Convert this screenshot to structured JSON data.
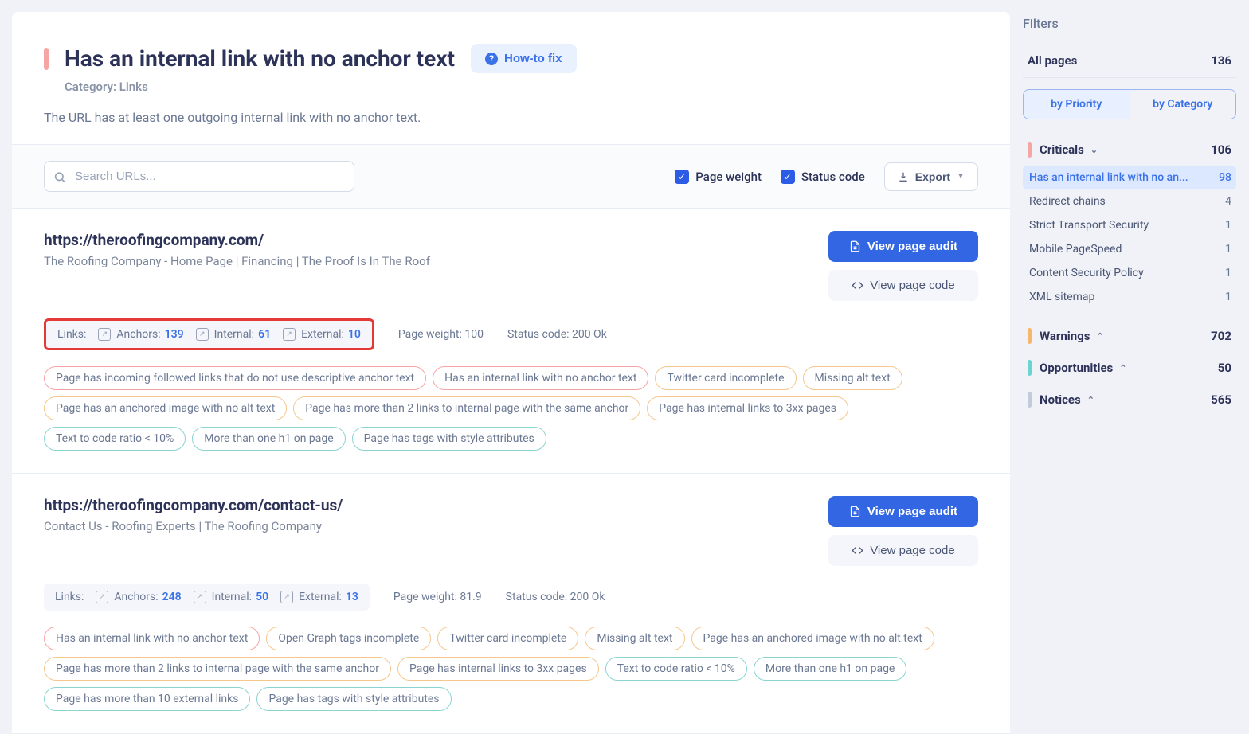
{
  "header": {
    "title": "Has an internal link with no anchor text",
    "howto": "How-to fix",
    "category": "Category: Links",
    "description": "The URL has at least one outgoing internal link with no anchor text."
  },
  "toolbar": {
    "search_placeholder": "Search URLs...",
    "page_weight": "Page weight",
    "status_code": "Status code",
    "export": "Export"
  },
  "labels": {
    "links": "Links:",
    "anchors": "Anchors:",
    "internal": "Internal:",
    "external": "External:",
    "page_weight": "Page weight:",
    "status_code": "Status code:",
    "view_audit": "View page audit",
    "view_code": "View page code"
  },
  "results": [
    {
      "url": "https://theroofingcompany.com/",
      "title": "The Roofing Company - Home Page | Financing | The Proof Is In The Roof",
      "highlighted": true,
      "anchors": "139",
      "internal": "61",
      "external": "10",
      "page_weight": "100",
      "status_code": "200 Ok",
      "tags": [
        {
          "t": "Page has incoming followed links that do not use descriptive anchor text",
          "c": "pink"
        },
        {
          "t": "Has an internal link with no anchor text",
          "c": "pink"
        },
        {
          "t": "Twitter card incomplete",
          "c": "orange"
        },
        {
          "t": "Missing alt text",
          "c": "orange"
        },
        {
          "t": "Page has an anchored image with no alt text",
          "c": "orange"
        },
        {
          "t": "Page has more than 2 links to internal page with the same anchor",
          "c": "orange"
        },
        {
          "t": "Page has internal links to 3xx pages",
          "c": "orange"
        },
        {
          "t": "Text to code ratio < 10%",
          "c": "teal"
        },
        {
          "t": "More than one h1 on page",
          "c": "teal"
        },
        {
          "t": "Page has tags with style attributes",
          "c": "teal"
        }
      ]
    },
    {
      "url": "https://theroofingcompany.com/contact-us/",
      "title": "Contact Us - Roofing Experts | The Roofing Company",
      "highlighted": false,
      "anchors": "248",
      "internal": "50",
      "external": "13",
      "page_weight": "81.9",
      "status_code": "200 Ok",
      "tags": [
        {
          "t": "Has an internal link with no anchor text",
          "c": "pink"
        },
        {
          "t": "Open Graph tags incomplete",
          "c": "orange"
        },
        {
          "t": "Twitter card incomplete",
          "c": "orange"
        },
        {
          "t": "Missing alt text",
          "c": "orange"
        },
        {
          "t": "Page has an anchored image with no alt text",
          "c": "orange"
        },
        {
          "t": "Page has more than 2 links to internal page with the same anchor",
          "c": "orange"
        },
        {
          "t": "Page has internal links to 3xx pages",
          "c": "orange"
        },
        {
          "t": "Text to code ratio < 10%",
          "c": "teal"
        },
        {
          "t": "More than one h1 on page",
          "c": "teal"
        },
        {
          "t": "Page has more than 10 external links",
          "c": "teal"
        },
        {
          "t": "Page has tags with style attributes",
          "c": "teal"
        }
      ]
    }
  ],
  "sidebar": {
    "title": "Filters",
    "all_pages": "All pages",
    "all_pages_count": "136",
    "tab_priority": "by Priority",
    "tab_category": "by Category",
    "sections": [
      {
        "name": "Criticals",
        "count": "106",
        "marker": "m-pink",
        "expanded": true,
        "items": [
          {
            "label": "Has an internal link with no an...",
            "count": "98",
            "active": true
          },
          {
            "label": "Redirect chains",
            "count": "4"
          },
          {
            "label": "Strict Transport Security",
            "count": "1"
          },
          {
            "label": "Mobile PageSpeed",
            "count": "1"
          },
          {
            "label": "Content Security Policy",
            "count": "1"
          },
          {
            "label": "XML sitemap",
            "count": "1"
          }
        ]
      },
      {
        "name": "Warnings",
        "count": "702",
        "marker": "m-orange",
        "expanded": false,
        "items": []
      },
      {
        "name": "Opportunities",
        "count": "50",
        "marker": "m-teal",
        "expanded": false,
        "items": []
      },
      {
        "name": "Notices",
        "count": "565",
        "marker": "m-gray",
        "expanded": false,
        "items": []
      }
    ]
  }
}
